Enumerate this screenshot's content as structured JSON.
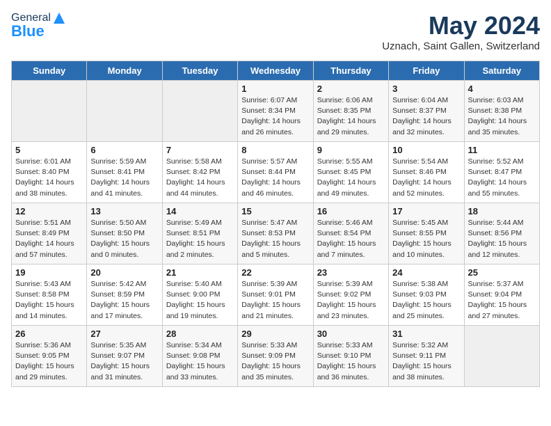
{
  "logo": {
    "line1": "General",
    "line2": "Blue"
  },
  "title": "May 2024",
  "subtitle": "Uznach, Saint Gallen, Switzerland",
  "days_of_week": [
    "Sunday",
    "Monday",
    "Tuesday",
    "Wednesday",
    "Thursday",
    "Friday",
    "Saturday"
  ],
  "weeks": [
    [
      {
        "day": "",
        "info": ""
      },
      {
        "day": "",
        "info": ""
      },
      {
        "day": "",
        "info": ""
      },
      {
        "day": "1",
        "info": "Sunrise: 6:07 AM\nSunset: 8:34 PM\nDaylight: 14 hours\nand 26 minutes."
      },
      {
        "day": "2",
        "info": "Sunrise: 6:06 AM\nSunset: 8:35 PM\nDaylight: 14 hours\nand 29 minutes."
      },
      {
        "day": "3",
        "info": "Sunrise: 6:04 AM\nSunset: 8:37 PM\nDaylight: 14 hours\nand 32 minutes."
      },
      {
        "day": "4",
        "info": "Sunrise: 6:03 AM\nSunset: 8:38 PM\nDaylight: 14 hours\nand 35 minutes."
      }
    ],
    [
      {
        "day": "5",
        "info": "Sunrise: 6:01 AM\nSunset: 8:40 PM\nDaylight: 14 hours\nand 38 minutes."
      },
      {
        "day": "6",
        "info": "Sunrise: 5:59 AM\nSunset: 8:41 PM\nDaylight: 14 hours\nand 41 minutes."
      },
      {
        "day": "7",
        "info": "Sunrise: 5:58 AM\nSunset: 8:42 PM\nDaylight: 14 hours\nand 44 minutes."
      },
      {
        "day": "8",
        "info": "Sunrise: 5:57 AM\nSunset: 8:44 PM\nDaylight: 14 hours\nand 46 minutes."
      },
      {
        "day": "9",
        "info": "Sunrise: 5:55 AM\nSunset: 8:45 PM\nDaylight: 14 hours\nand 49 minutes."
      },
      {
        "day": "10",
        "info": "Sunrise: 5:54 AM\nSunset: 8:46 PM\nDaylight: 14 hours\nand 52 minutes."
      },
      {
        "day": "11",
        "info": "Sunrise: 5:52 AM\nSunset: 8:47 PM\nDaylight: 14 hours\nand 55 minutes."
      }
    ],
    [
      {
        "day": "12",
        "info": "Sunrise: 5:51 AM\nSunset: 8:49 PM\nDaylight: 14 hours\nand 57 minutes."
      },
      {
        "day": "13",
        "info": "Sunrise: 5:50 AM\nSunset: 8:50 PM\nDaylight: 15 hours\nand 0 minutes."
      },
      {
        "day": "14",
        "info": "Sunrise: 5:49 AM\nSunset: 8:51 PM\nDaylight: 15 hours\nand 2 minutes."
      },
      {
        "day": "15",
        "info": "Sunrise: 5:47 AM\nSunset: 8:53 PM\nDaylight: 15 hours\nand 5 minutes."
      },
      {
        "day": "16",
        "info": "Sunrise: 5:46 AM\nSunset: 8:54 PM\nDaylight: 15 hours\nand 7 minutes."
      },
      {
        "day": "17",
        "info": "Sunrise: 5:45 AM\nSunset: 8:55 PM\nDaylight: 15 hours\nand 10 minutes."
      },
      {
        "day": "18",
        "info": "Sunrise: 5:44 AM\nSunset: 8:56 PM\nDaylight: 15 hours\nand 12 minutes."
      }
    ],
    [
      {
        "day": "19",
        "info": "Sunrise: 5:43 AM\nSunset: 8:58 PM\nDaylight: 15 hours\nand 14 minutes."
      },
      {
        "day": "20",
        "info": "Sunrise: 5:42 AM\nSunset: 8:59 PM\nDaylight: 15 hours\nand 17 minutes."
      },
      {
        "day": "21",
        "info": "Sunrise: 5:40 AM\nSunset: 9:00 PM\nDaylight: 15 hours\nand 19 minutes."
      },
      {
        "day": "22",
        "info": "Sunrise: 5:39 AM\nSunset: 9:01 PM\nDaylight: 15 hours\nand 21 minutes."
      },
      {
        "day": "23",
        "info": "Sunrise: 5:39 AM\nSunset: 9:02 PM\nDaylight: 15 hours\nand 23 minutes."
      },
      {
        "day": "24",
        "info": "Sunrise: 5:38 AM\nSunset: 9:03 PM\nDaylight: 15 hours\nand 25 minutes."
      },
      {
        "day": "25",
        "info": "Sunrise: 5:37 AM\nSunset: 9:04 PM\nDaylight: 15 hours\nand 27 minutes."
      }
    ],
    [
      {
        "day": "26",
        "info": "Sunrise: 5:36 AM\nSunset: 9:05 PM\nDaylight: 15 hours\nand 29 minutes."
      },
      {
        "day": "27",
        "info": "Sunrise: 5:35 AM\nSunset: 9:07 PM\nDaylight: 15 hours\nand 31 minutes."
      },
      {
        "day": "28",
        "info": "Sunrise: 5:34 AM\nSunset: 9:08 PM\nDaylight: 15 hours\nand 33 minutes."
      },
      {
        "day": "29",
        "info": "Sunrise: 5:33 AM\nSunset: 9:09 PM\nDaylight: 15 hours\nand 35 minutes."
      },
      {
        "day": "30",
        "info": "Sunrise: 5:33 AM\nSunset: 9:10 PM\nDaylight: 15 hours\nand 36 minutes."
      },
      {
        "day": "31",
        "info": "Sunrise: 5:32 AM\nSunset: 9:11 PM\nDaylight: 15 hours\nand 38 minutes."
      },
      {
        "day": "",
        "info": ""
      }
    ]
  ]
}
